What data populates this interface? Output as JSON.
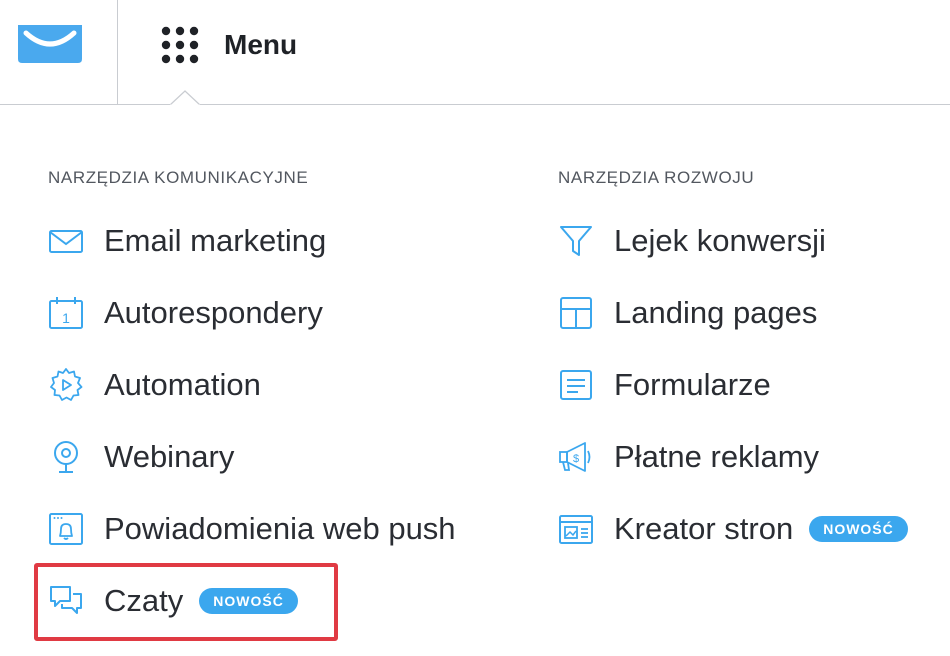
{
  "header": {
    "menu_label": "Menu"
  },
  "columns": [
    {
      "heading": "NARZĘDZIA KOMUNIKACYJNE",
      "items": [
        {
          "label": "Email marketing",
          "icon": "envelope-icon"
        },
        {
          "label": "Autorespondery",
          "icon": "calendar-icon"
        },
        {
          "label": "Automation",
          "icon": "gear-play-icon"
        },
        {
          "label": "Webinary",
          "icon": "webcam-icon"
        },
        {
          "label": "Powiadomienia web push",
          "icon": "browser-bell-icon"
        },
        {
          "label": "Czaty",
          "icon": "chat-bubbles-icon",
          "badge": "NOWOŚĆ"
        }
      ]
    },
    {
      "heading": "NARZĘDZIA ROZWOJU",
      "items": [
        {
          "label": "Lejek konwersji",
          "icon": "funnel-icon"
        },
        {
          "label": "Landing pages",
          "icon": "layout-icon"
        },
        {
          "label": "Formularze",
          "icon": "form-icon"
        },
        {
          "label": "Płatne reklamy",
          "icon": "megaphone-dollar-icon"
        },
        {
          "label": "Kreator stron",
          "icon": "website-builder-icon",
          "badge": "NOWOŚĆ"
        }
      ]
    }
  ],
  "colors": {
    "icon": "#3ba7ee",
    "badge": "#3ba7ee",
    "highlight": "#e03a43",
    "logo": "#4aa9ee"
  }
}
